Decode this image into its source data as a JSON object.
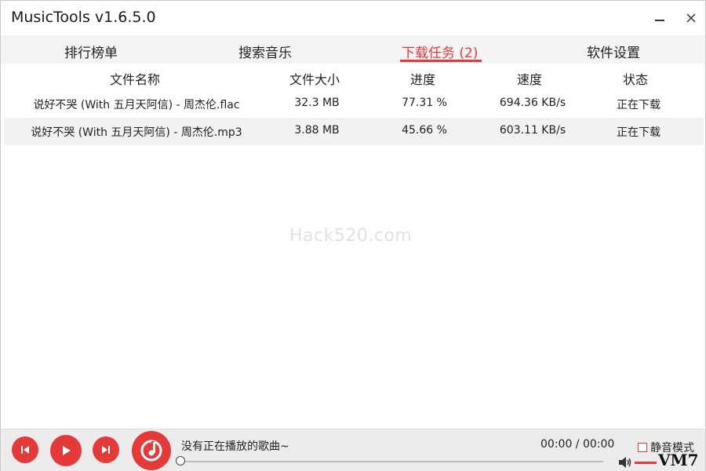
{
  "window": {
    "title": "MusicTools v1.6.5.0"
  },
  "tabs": [
    {
      "label": "排行榜单"
    },
    {
      "label": "搜索音乐"
    },
    {
      "label": "下载任务 (2)"
    },
    {
      "label": "软件设置"
    }
  ],
  "active_tab": 2,
  "table": {
    "columns": [
      "文件名称",
      "文件大小",
      "进度",
      "速度",
      "状态"
    ],
    "rows": [
      [
        "说好不哭 (With 五月天阿信) - 周杰伦.flac",
        "32.3 MB",
        "77.31 %",
        "694.36 KB/s",
        "正在下载"
      ],
      [
        "说好不哭 (With 五月天阿信) - 周杰伦.mp3",
        "3.88 MB",
        "45.66 %",
        "603.11 KB/s",
        "正在下载"
      ]
    ]
  },
  "watermark": "Hack520.com",
  "player": {
    "now_playing": "没有正在播放的歌曲~",
    "time": "00:00 / 00:00",
    "mute_label": "静音模式",
    "mute_checked": false,
    "progress": 0
  },
  "logo": "VM7",
  "colors": {
    "accent": "#e53a3a",
    "tab_bar_bg": "#f4f4f4",
    "player_bg": "#ececec",
    "alt_row_bg": "#f2f2f2"
  },
  "icons": {
    "minimize": "minimize-icon",
    "close": "close-icon",
    "prev": "skip-previous-icon",
    "play": "play-icon",
    "next": "skip-next-icon",
    "music": "music-note-icon",
    "volume": "volume-icon"
  }
}
